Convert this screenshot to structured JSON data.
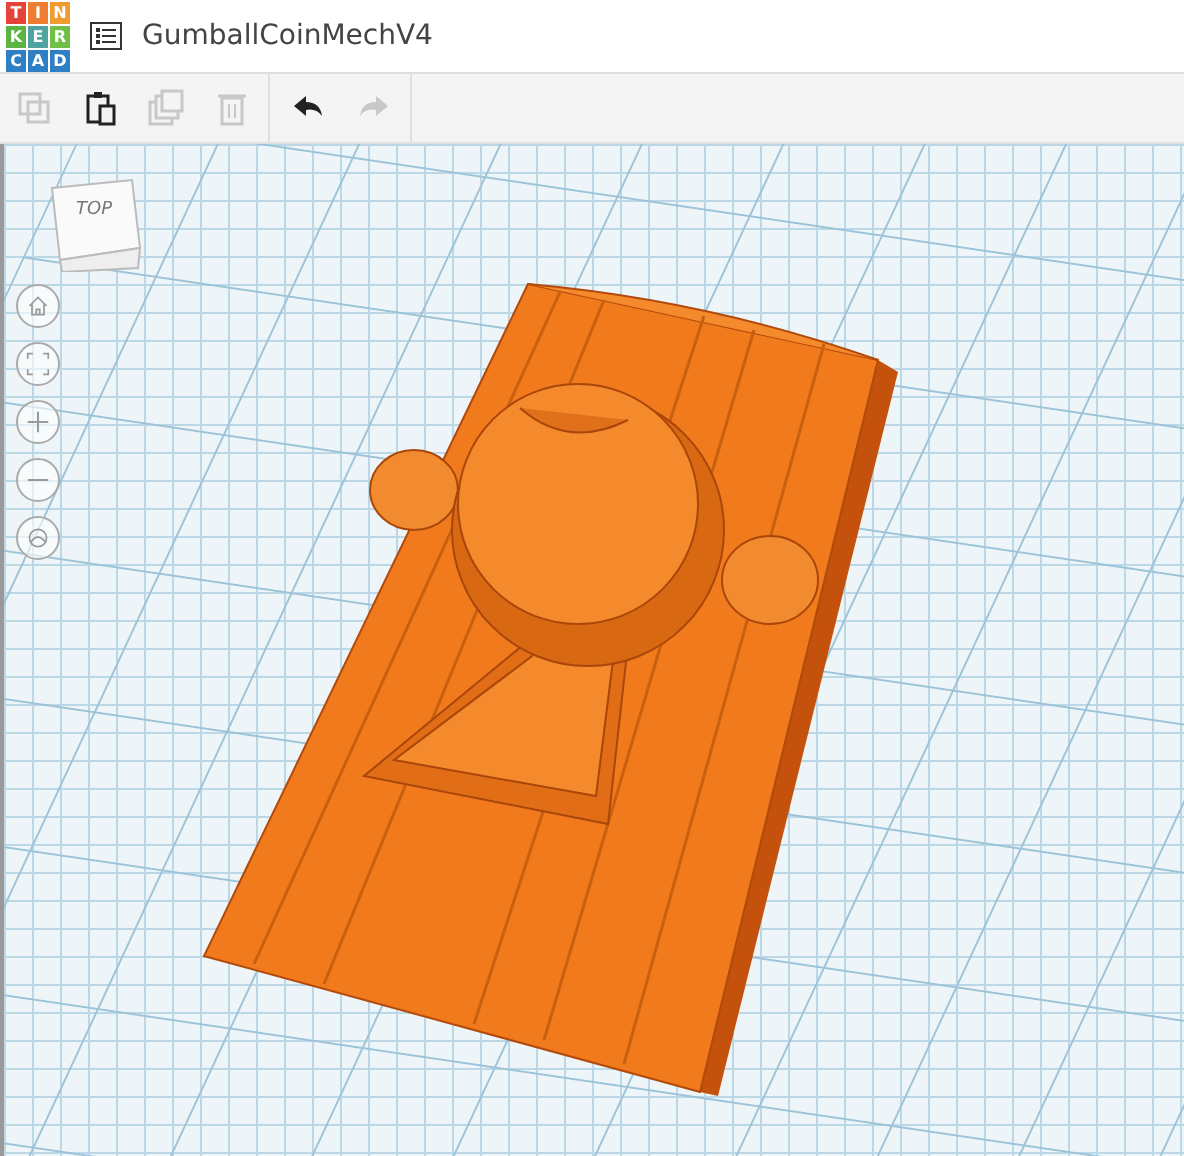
{
  "logo": {
    "letters": [
      {
        "char": "T",
        "color": "#e5423a"
      },
      {
        "char": "I",
        "color": "#ef7d31"
      },
      {
        "char": "N",
        "color": "#f09a32"
      },
      {
        "char": "K",
        "color": "#5cb443"
      },
      {
        "char": "E",
        "color": "#4fa3a0"
      },
      {
        "char": "R",
        "color": "#6fbf48"
      },
      {
        "char": "C",
        "color": "#2f7fc4"
      },
      {
        "char": "A",
        "color": "#2f7fc4"
      },
      {
        "char": "D",
        "color": "#2f7fc4"
      }
    ]
  },
  "title": "GumballCoinMechV4",
  "toolbar": [
    {
      "kind": "copy",
      "disabled": true
    },
    {
      "kind": "paste",
      "disabled": false
    },
    {
      "kind": "duplicate",
      "disabled": true
    },
    {
      "kind": "delete",
      "disabled": true
    },
    {
      "kind": "undo",
      "disabled": false
    },
    {
      "kind": "redo",
      "disabled": true
    }
  ],
  "view_cube": {
    "face": "TOP"
  },
  "nav_buttons": [
    {
      "kind": "home"
    },
    {
      "kind": "fit"
    },
    {
      "kind": "zoom_in"
    },
    {
      "kind": "zoom_out"
    },
    {
      "kind": "orbit"
    }
  ]
}
